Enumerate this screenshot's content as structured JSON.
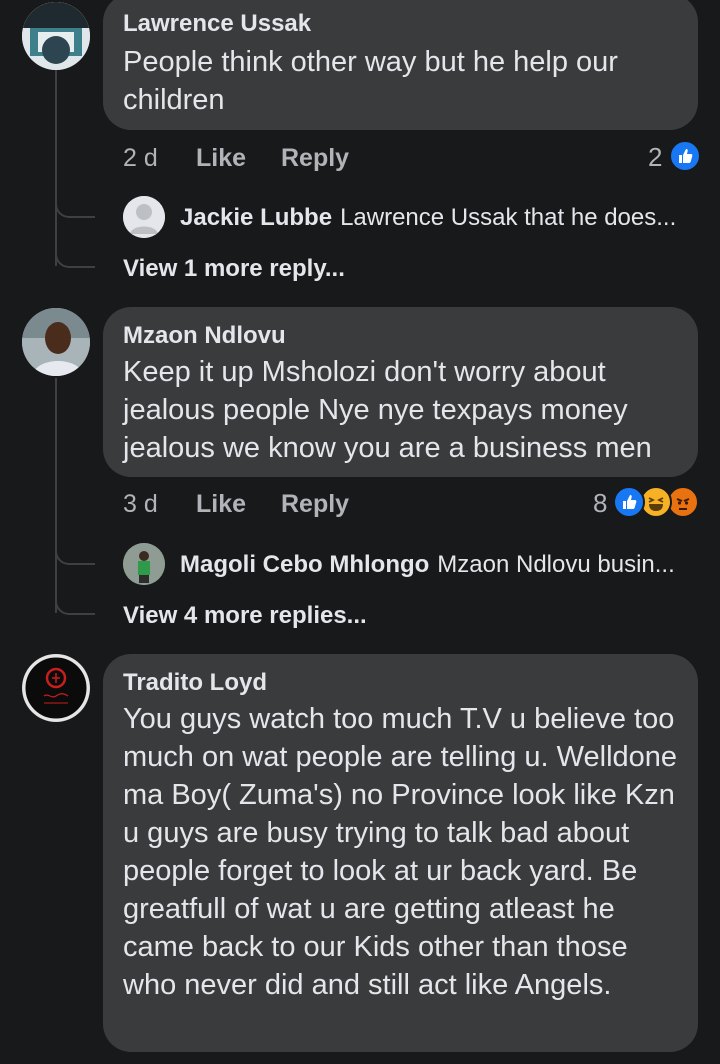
{
  "comments": [
    {
      "author": "Lawrence Ussak",
      "text": "People think other way but he help our children",
      "time": "2 d",
      "like_label": "Like",
      "reply_label": "Reply",
      "reaction_count": "2",
      "reply_preview": {
        "author": "Jackie Lubbe",
        "text": "Lawrence Ussak that he does..."
      },
      "view_more": "View 1 more reply..."
    },
    {
      "author": "Mzaon Ndlovu",
      "text": "Keep it up Msholozi don't worry about jealous people Nye nye texpays money jealous we know you are a business men",
      "time": "3 d",
      "like_label": "Like",
      "reply_label": "Reply",
      "reaction_count": "8",
      "reply_preview": {
        "author": "Magoli Cebo Mhlongo",
        "text": "Mzaon Ndlovu busin..."
      },
      "view_more": "View 4 more replies..."
    },
    {
      "author": "Tradito Loyd",
      "text": "You guys watch too much T.V u believe too much on wat people are telling u. Welldone ma Boy( Zuma's) no Province look like Kzn u guys are busy trying to talk bad about people forget to look at ur back yard.  Be greatfull of wat u are getting atleast he came back to our Kids other than those who never did and still act like Angels."
    }
  ],
  "colors": {
    "background": "#18191a",
    "bubble": "#3a3b3c",
    "like_blue": "#1877f2",
    "haha_yellow": "#f7b125",
    "angry_orange": "#e9710f"
  }
}
